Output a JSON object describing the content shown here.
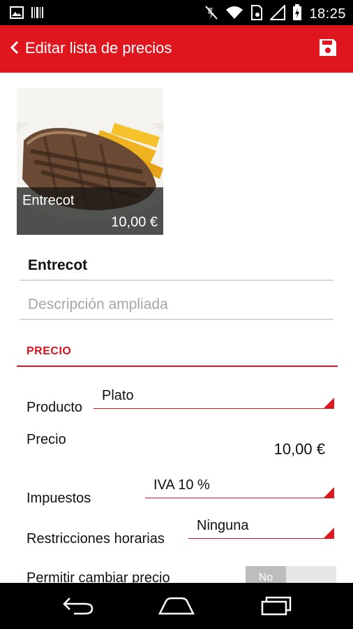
{
  "status_bar": {
    "time": "18:25"
  },
  "app_bar": {
    "title": "Editar lista de precios"
  },
  "dish_card": {
    "name": "Entrecot",
    "price": "10,00 €"
  },
  "form": {
    "name_value": "Entrecot",
    "description_placeholder": "Descripción ampliada"
  },
  "price_section": {
    "header": "PRECIO",
    "producto": {
      "label": "Producto",
      "value": "Plato"
    },
    "precio": {
      "label": "Precio",
      "value": "10,00 €"
    },
    "impuestos": {
      "label": "Impuestos",
      "value": "IVA 10 %"
    },
    "restricciones": {
      "label": "Restricciones horarias",
      "value": "Ninguna"
    },
    "permitir_cambiar_precio": {
      "label": "Permitir cambiar precio",
      "toggle_label": "No",
      "state": "off"
    }
  },
  "colors": {
    "accent": "#e0161e",
    "status_bar": "#000000",
    "nav_bar": "#000000"
  },
  "icons": {
    "back": "chevron-left-icon",
    "save": "save-icon",
    "nav_back": "nav-back-icon",
    "nav_home": "nav-home-icon",
    "nav_recents": "nav-recents-icon"
  }
}
